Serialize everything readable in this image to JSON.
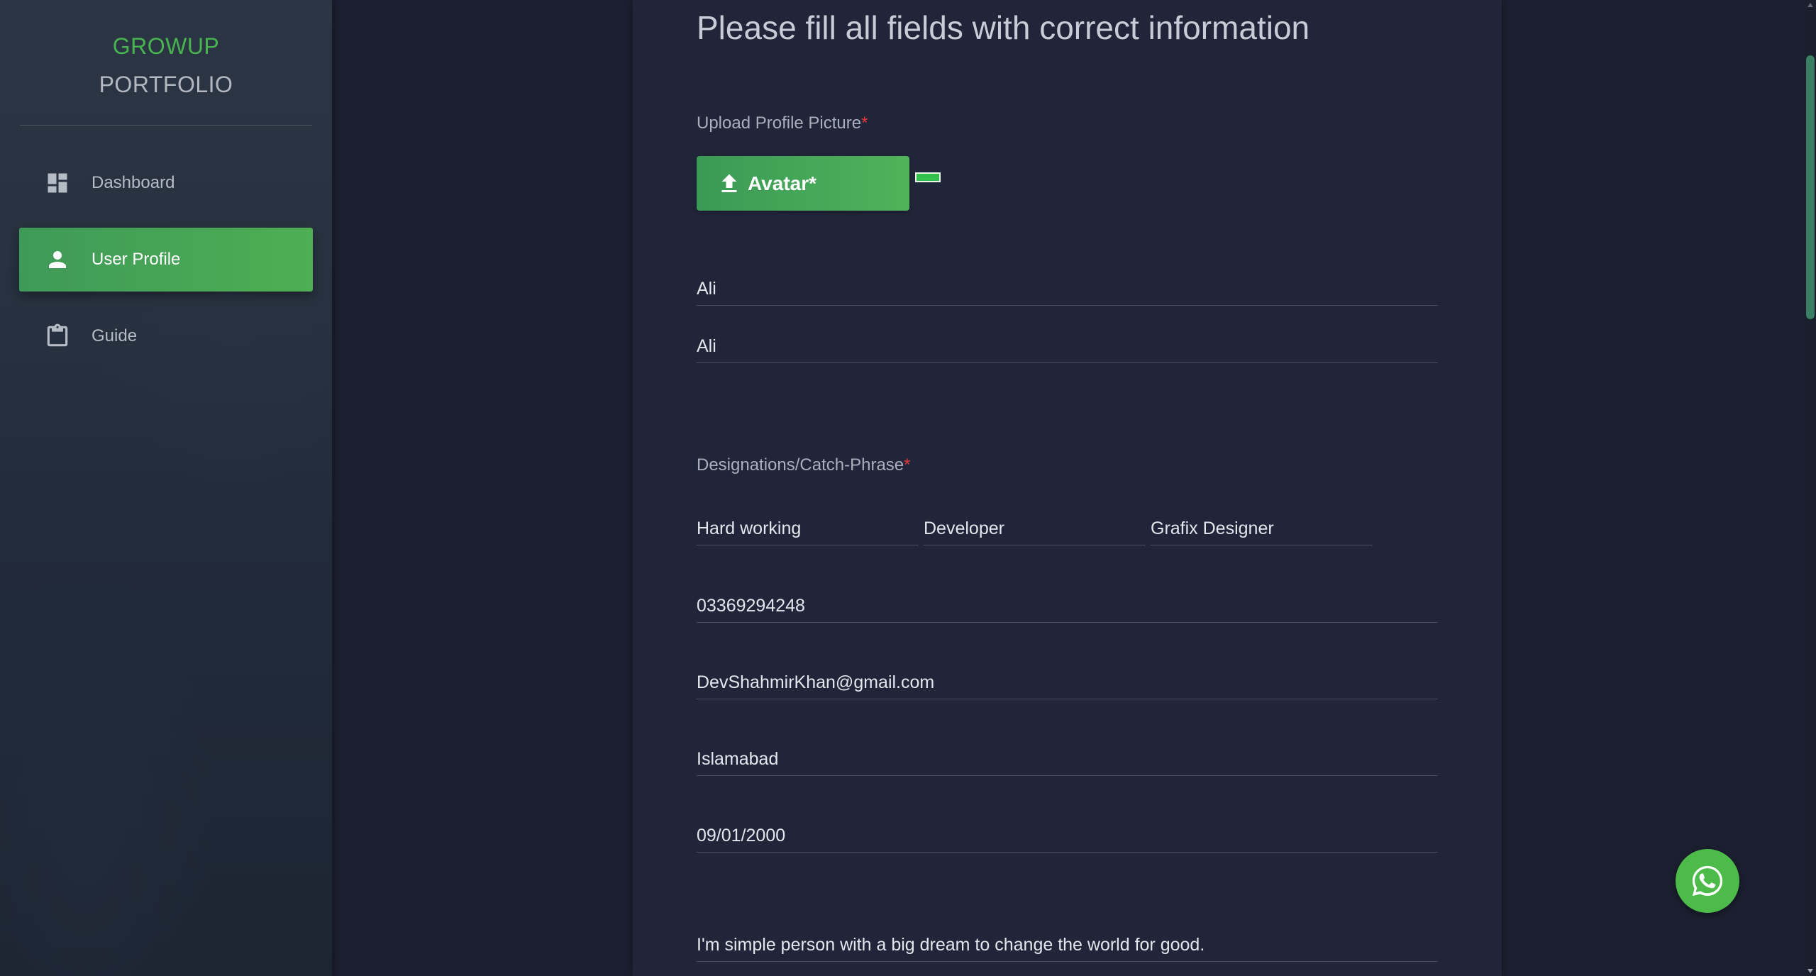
{
  "sidebar": {
    "logo_line1": "GROWUP",
    "logo_line2": "PORTFOLIO",
    "items": [
      {
        "label": "Dashboard",
        "icon": "dashboard-icon"
      },
      {
        "label": "User Profile",
        "icon": "person-icon",
        "active": true
      },
      {
        "label": "Guide",
        "icon": "clipboard-icon"
      }
    ]
  },
  "form": {
    "title": "Please fill all fields with correct information",
    "upload_label": "Upload Profile Picture",
    "required_mark": "*",
    "avatar_button_label": "Avatar*",
    "first_name": "Ali",
    "last_name": "Ali",
    "designations_label": "Designations/Catch-Phrase",
    "designation_1": "Hard working",
    "designation_2": "Developer",
    "designation_3": "Grafix Designer",
    "phone": "03369294248",
    "email": "DevShahmirKhan@gmail.com",
    "city": "Islamabad",
    "dob": "09/01/2000",
    "bio": "I'm simple person with a big dream to change the world for good."
  },
  "colors": {
    "accent": "#4caf50",
    "background": "#1b1f30",
    "card": "#202539",
    "required": "#e53935",
    "whatsapp": "#4cbb4a"
  }
}
